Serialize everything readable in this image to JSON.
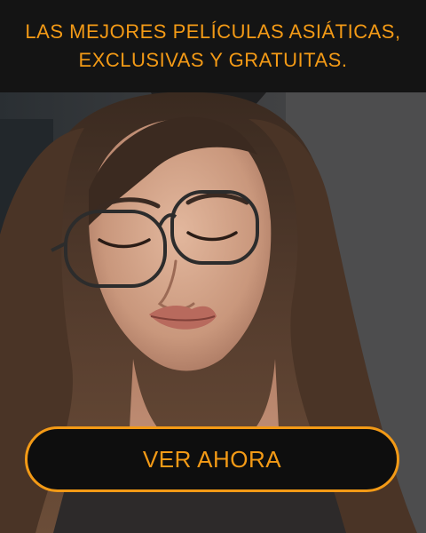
{
  "ad": {
    "headline_line1": "LAS MEJORES PELÍCULAS ASIÁTICAS,",
    "headline_line2": "EXCLUSIVAS Y GRATUITAS.",
    "cta_label": "VER AHORA"
  },
  "colors": {
    "accent": "#f39a16",
    "header_background": "#141414",
    "button_background": "#0e0e0e"
  },
  "image": {
    "subject": "webcam-style portrait photo"
  }
}
